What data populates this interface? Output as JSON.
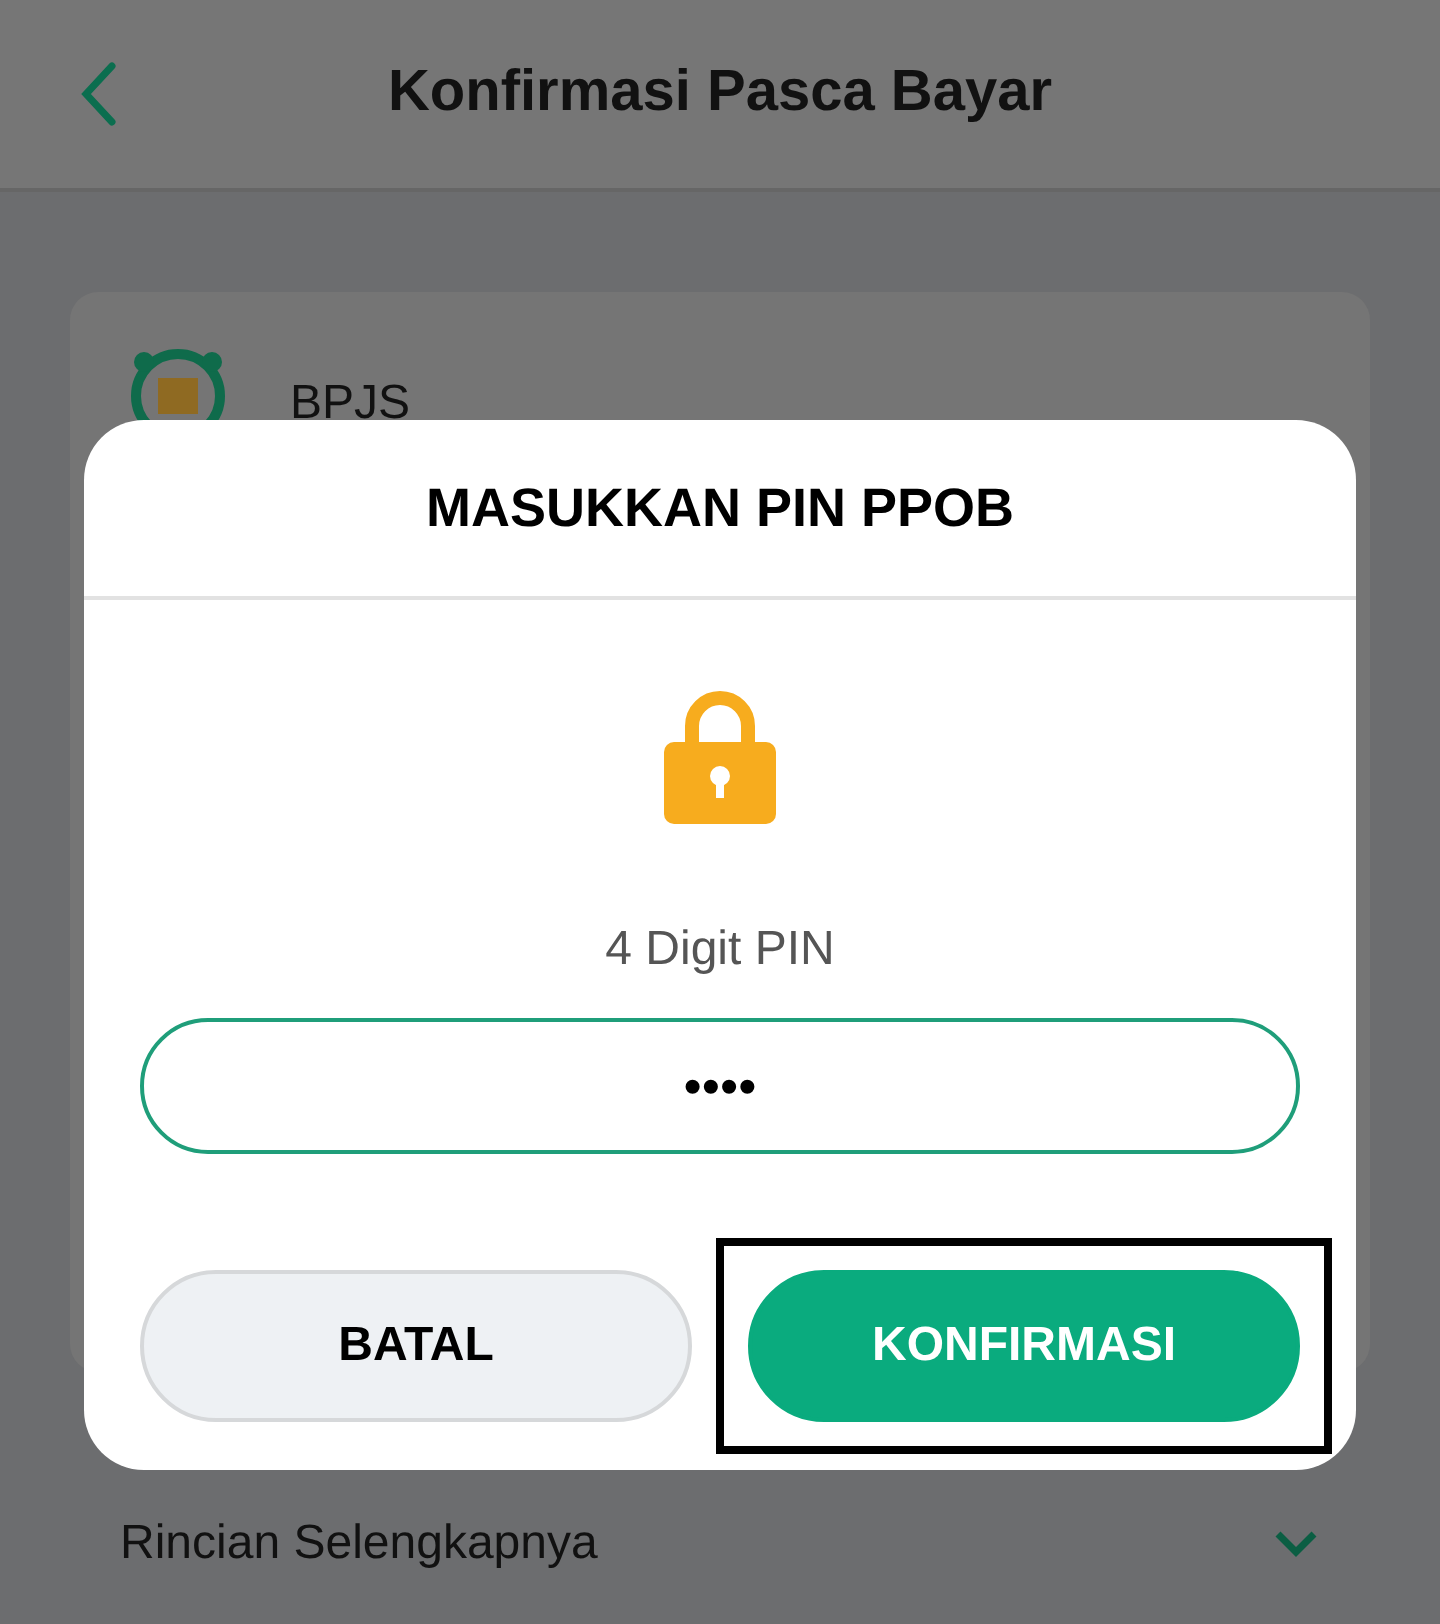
{
  "header": {
    "title": "Konfirmasi Pasca Bayar"
  },
  "card": {
    "provider": "BPJS"
  },
  "details_toggle": {
    "label": "Rincian Selengkapnya",
    "expanded": false
  },
  "dialog": {
    "title": "MASUKKAN PIN PPOB",
    "field_label": "4 Digit PIN",
    "pin": {
      "value": "••••"
    },
    "buttons": [
      {
        "kind": "secondary",
        "label": "BATAL",
        "highlighted": false
      },
      {
        "kind": "primary",
        "label": "KONFIRMASI",
        "highlighted": true
      }
    ]
  }
}
